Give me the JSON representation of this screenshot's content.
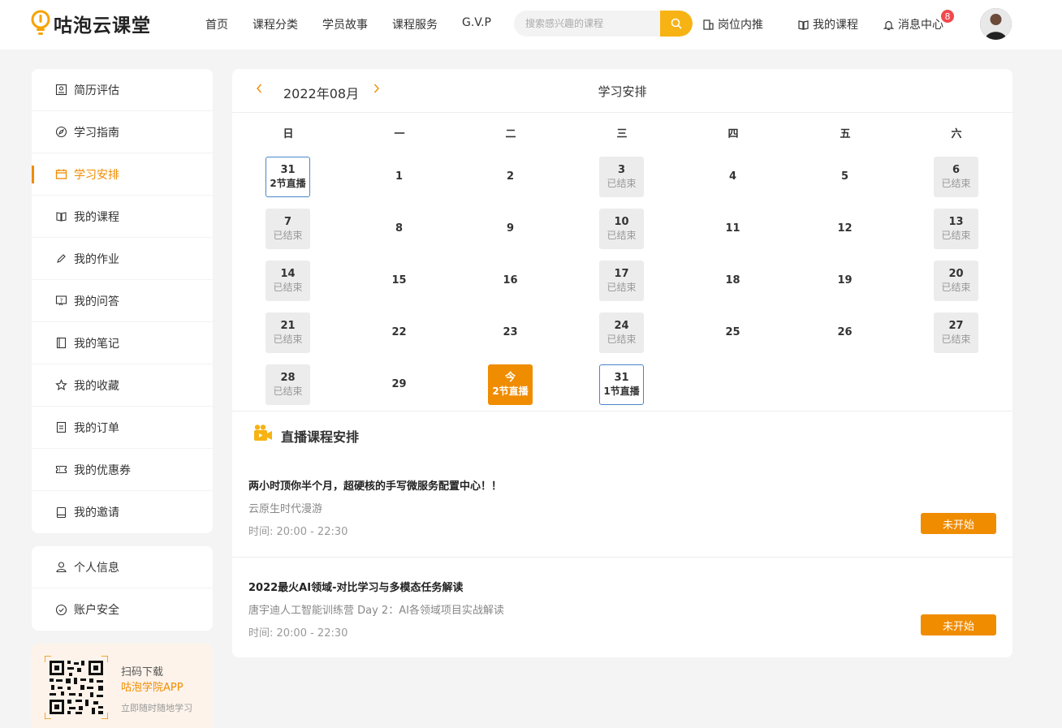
{
  "brand": {
    "name": "咕泡云课堂"
  },
  "nav": [
    "首页",
    "课程分类",
    "学员故事",
    "课程服务",
    "G.V.P"
  ],
  "search": {
    "placeholder": "搜索感兴趣的课程"
  },
  "header_links": {
    "jobs": "岗位内推",
    "my_courses": "我的课程",
    "messages": "消息中心",
    "message_count": "8"
  },
  "sidebar": {
    "items": [
      {
        "label": "简历评估",
        "icon": "resume-icon"
      },
      {
        "label": "学习指南",
        "icon": "compass-icon"
      },
      {
        "label": "学习安排",
        "icon": "calendar-icon",
        "active": true
      },
      {
        "label": "我的课程",
        "icon": "book-icon"
      },
      {
        "label": "我的作业",
        "icon": "pen-icon"
      },
      {
        "label": "我的问答",
        "icon": "question-icon"
      },
      {
        "label": "我的笔记",
        "icon": "notebook-icon"
      },
      {
        "label": "我的收藏",
        "icon": "star-icon"
      },
      {
        "label": "我的订单",
        "icon": "order-icon"
      },
      {
        "label": "我的优惠券",
        "icon": "coupon-icon"
      },
      {
        "label": "我的邀请",
        "icon": "invite-icon"
      }
    ],
    "account": [
      {
        "label": "个人信息",
        "icon": "user-icon"
      },
      {
        "label": "账户安全",
        "icon": "shield-check-icon"
      }
    ]
  },
  "app_promo": {
    "line1": "扫码下载",
    "line2": "咕泡学院APP",
    "line3": "立即随时随地学习"
  },
  "calendar": {
    "month": "2022年08月",
    "title": "学习安排",
    "weekdays": [
      "日",
      "一",
      "二",
      "三",
      "四",
      "五",
      "六"
    ],
    "weeks": [
      [
        {
          "n": "31",
          "s": "2节直播",
          "t": "live"
        },
        {
          "n": "1"
        },
        {
          "n": "2"
        },
        {
          "n": "3",
          "s": "已结束",
          "t": "ended"
        },
        {
          "n": "4"
        },
        {
          "n": "5"
        },
        {
          "n": "6",
          "s": "已结束",
          "t": "ended"
        }
      ],
      [
        {
          "n": "7",
          "s": "已结束",
          "t": "ended"
        },
        {
          "n": "8"
        },
        {
          "n": "9"
        },
        {
          "n": "10",
          "s": "已结束",
          "t": "ended"
        },
        {
          "n": "11"
        },
        {
          "n": "12"
        },
        {
          "n": "13",
          "s": "已结束",
          "t": "ended"
        }
      ],
      [
        {
          "n": "14",
          "s": "已结束",
          "t": "ended"
        },
        {
          "n": "15"
        },
        {
          "n": "16"
        },
        {
          "n": "17",
          "s": "已结束",
          "t": "ended"
        },
        {
          "n": "18"
        },
        {
          "n": "19"
        },
        {
          "n": "20",
          "s": "已结束",
          "t": "ended"
        }
      ],
      [
        {
          "n": "21",
          "s": "已结束",
          "t": "ended"
        },
        {
          "n": "22"
        },
        {
          "n": "23"
        },
        {
          "n": "24",
          "s": "已结束",
          "t": "ended"
        },
        {
          "n": "25"
        },
        {
          "n": "26"
        },
        {
          "n": "27",
          "s": "已结束",
          "t": "ended"
        }
      ],
      [
        {
          "n": "28",
          "s": "已结束",
          "t": "ended"
        },
        {
          "n": "29"
        },
        {
          "n": "今",
          "s": "2节直播",
          "t": "today"
        },
        {
          "n": "31",
          "s": "1节直播",
          "t": "live"
        }
      ]
    ]
  },
  "live_section": {
    "title": "直播课程安排",
    "courses": [
      {
        "title": "两小时顶你半个月，超硬核的手写微服务配置中心！！",
        "subtitle": "云原生时代漫游",
        "time": "时间: 20:00 - 22:30",
        "status": "未开始"
      },
      {
        "title": "2022最火AI领域-对比学习与多模态任务解读",
        "subtitle": "唐宇迪人工智能训练营 Day 2：AI各领域项目实战解读",
        "time": "时间: 20:00 - 22:30",
        "status": "未开始"
      }
    ]
  },
  "colors": {
    "accent": "#f08c00",
    "search_button": "#f7b314",
    "badge": "#f0494d",
    "live_border": "#4a86c8"
  }
}
